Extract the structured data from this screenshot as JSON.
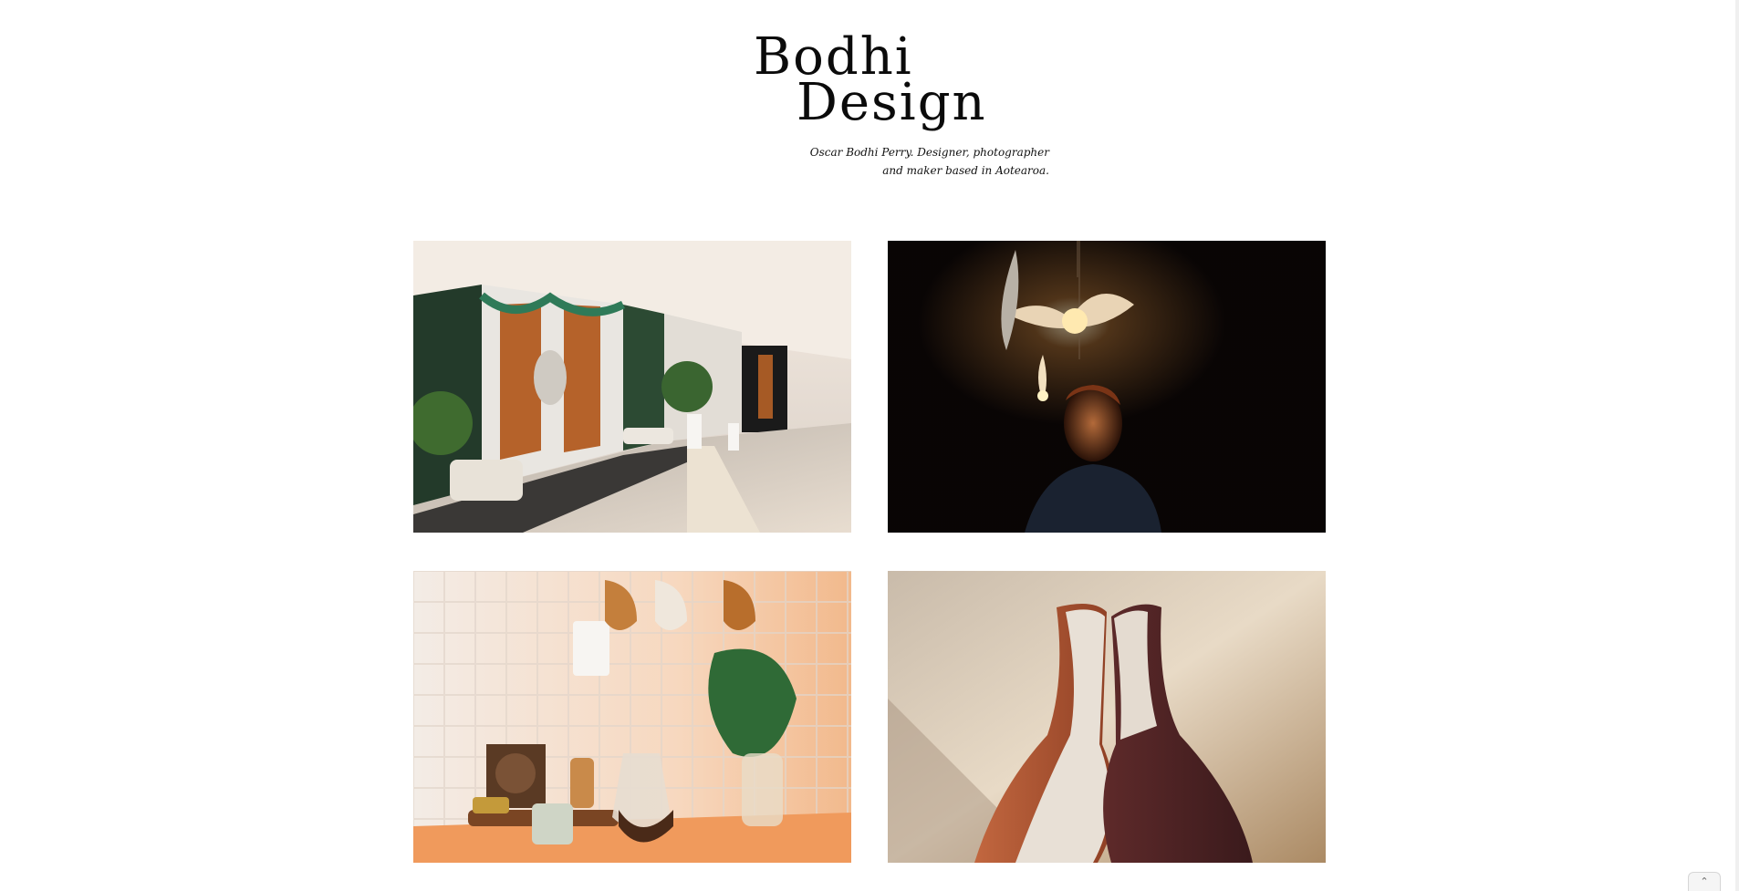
{
  "site": {
    "logo_line1": "Bodhi",
    "logo_line2": "Design",
    "tagline_line1": "Oscar Bodhi Perry. Designer, photographer",
    "tagline_line2": "and maker based in Aotearoa."
  },
  "gallery": [
    {
      "subject": "lobby interior with carved panels"
    },
    {
      "subject": "man beneath glowing lily pendant lamps"
    },
    {
      "subject": "kitchen shelf with hanging mugs and coffee maker"
    },
    {
      "subject": "two ceramic vases close-up"
    }
  ],
  "controls": {
    "scroll_top_icon": "chevron-up-icon",
    "scroll_top_glyph": "⌃"
  },
  "colors": {
    "background": "#ffffff",
    "text": "#111111"
  }
}
